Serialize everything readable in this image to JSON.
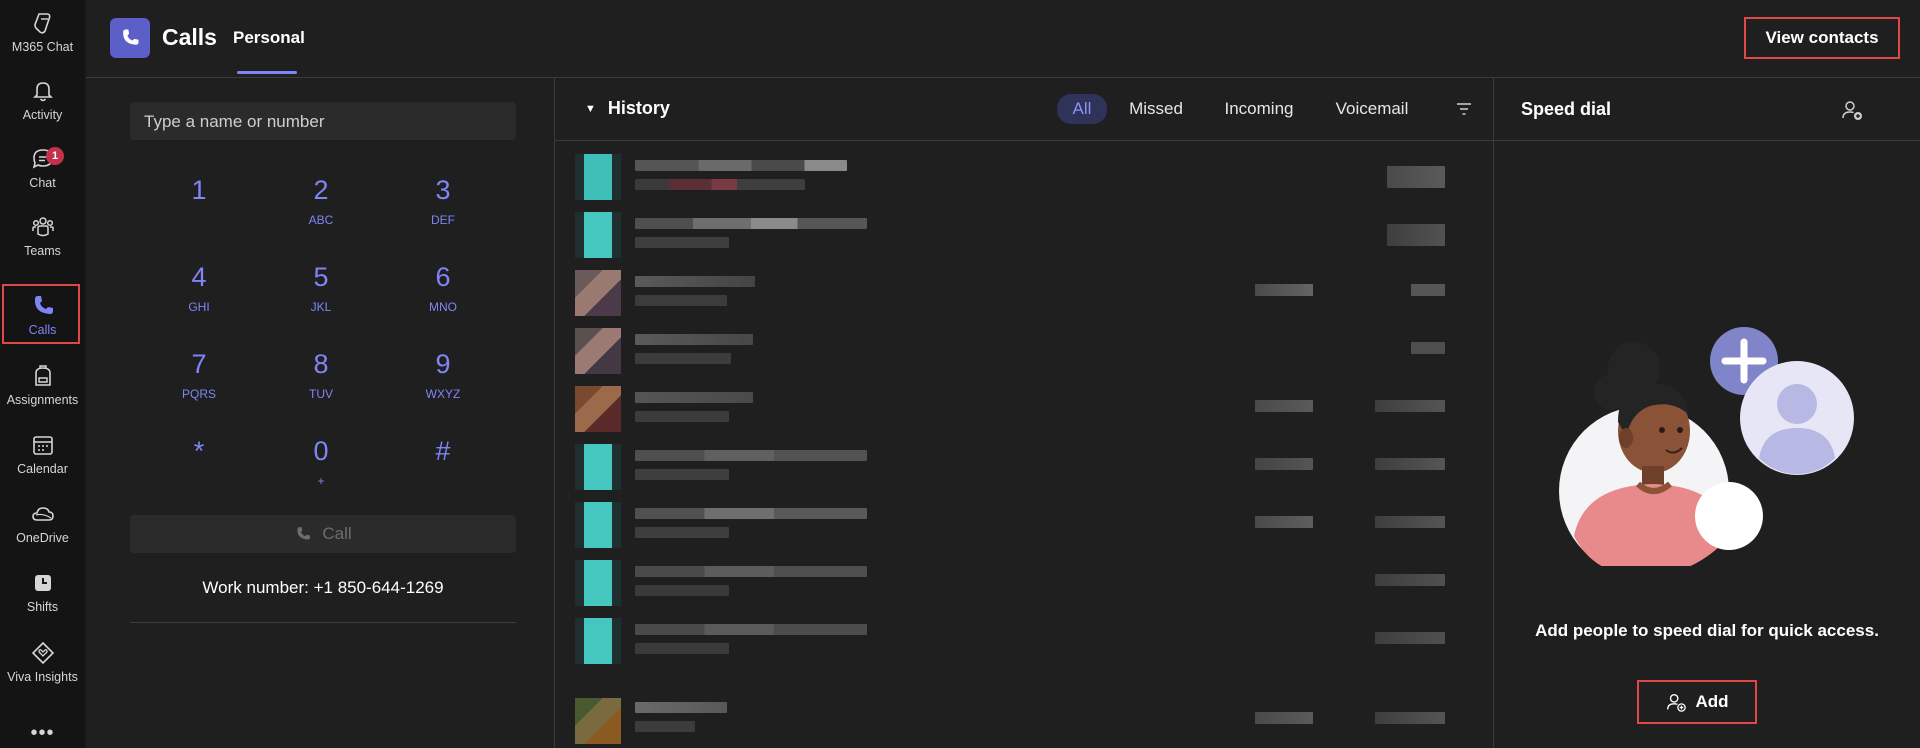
{
  "rail": {
    "items": [
      {
        "label": "M365 Chat",
        "icon": "m365-chat-icon"
      },
      {
        "label": "Activity",
        "icon": "bell-icon"
      },
      {
        "label": "Chat",
        "icon": "chat-icon",
        "badge": "1"
      },
      {
        "label": "Teams",
        "icon": "teams-icon"
      },
      {
        "label": "Calls",
        "icon": "phone-icon",
        "active": true
      },
      {
        "label": "Assignments",
        "icon": "backpack-icon"
      },
      {
        "label": "Calendar",
        "icon": "calendar-icon"
      },
      {
        "label": "OneDrive",
        "icon": "cloud-icon"
      },
      {
        "label": "Shifts",
        "icon": "clock-icon"
      },
      {
        "label": "Viva Insights",
        "icon": "heart-diamond-icon"
      }
    ],
    "more": "•••"
  },
  "header": {
    "title": "Calls",
    "tab": "Personal",
    "view_contacts": "View contacts"
  },
  "dialer": {
    "placeholder": "Type a name or number",
    "keys": [
      {
        "digit": "1",
        "letters": ""
      },
      {
        "digit": "2",
        "letters": "ABC"
      },
      {
        "digit": "3",
        "letters": "DEF"
      },
      {
        "digit": "4",
        "letters": "GHI"
      },
      {
        "digit": "5",
        "letters": "JKL"
      },
      {
        "digit": "6",
        "letters": "MNO"
      },
      {
        "digit": "7",
        "letters": "PQRS"
      },
      {
        "digit": "8",
        "letters": "TUV"
      },
      {
        "digit": "9",
        "letters": "WXYZ"
      },
      {
        "digit": "*",
        "letters": ""
      },
      {
        "digit": "0",
        "letters": "+"
      },
      {
        "digit": "#",
        "letters": ""
      }
    ],
    "call_label": "Call",
    "work_number": "Work number: +1 850-644-1269"
  },
  "history": {
    "title": "History",
    "filters": [
      "All",
      "Missed",
      "Incoming",
      "Voicemail"
    ],
    "active_filter": "All"
  },
  "speed_dial": {
    "title": "Speed dial",
    "message": "Add people to speed dial for quick access.",
    "add_label": "Add"
  },
  "colors": {
    "accent": "#7f85f5",
    "brand": "#5b5fc7",
    "highlight_border": "#e04848",
    "badge": "#c4314b"
  }
}
